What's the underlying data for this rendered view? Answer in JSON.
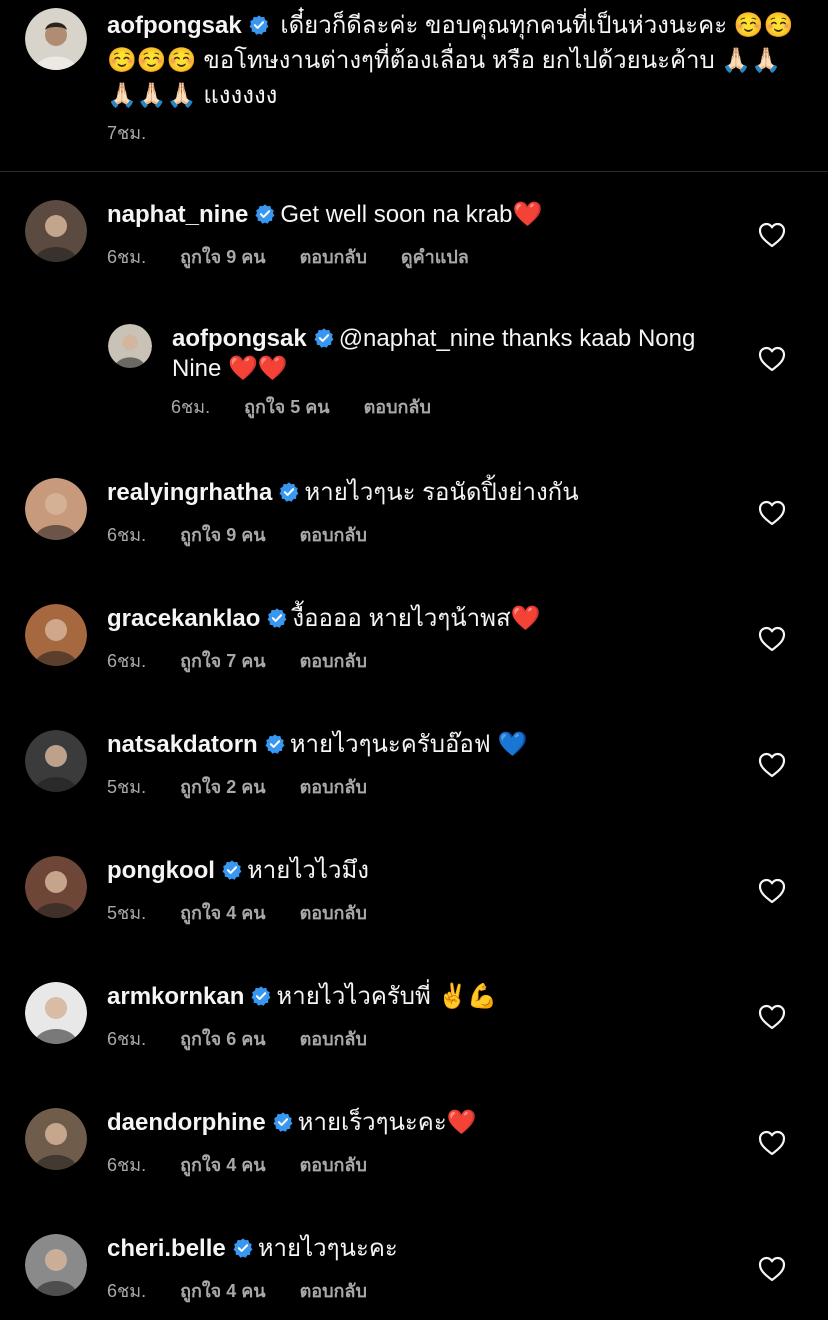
{
  "colors": {
    "background": "#000000",
    "text": "#f5f5f5",
    "secondary_text": "#a8a8a8",
    "verified_badge": "#3897f0",
    "divider": "#2a2a2a"
  },
  "icons": {
    "verified": "verified-badge-icon",
    "like": "heart-outline-icon"
  },
  "caption": {
    "username": "aofpongsak",
    "text": "เดี๋ยวก็ดีละค่ะ ขอบคุณทุกคนที่เป็นห่วงนะคะ ☺️☺️☺️☺️☺️ ขอโทษงานต่างๆที่ต้องเลื่อน หรือ ยกไปด้วยนะค้าบ 🙏🏻🙏🏻🙏🏻🙏🏻🙏🏻 แงงงงง",
    "time": "7ชม."
  },
  "comments": [
    {
      "username": "naphat_nine",
      "text": "Get well soon na krab❤️",
      "time": "6ชม.",
      "likes": "ถูกใจ 9 คน",
      "reply": "ตอบกลับ",
      "translate": "ดูคำแปล",
      "avatar_color": "#5b4a3f"
    },
    {
      "username": "aofpongsak",
      "text": "@naphat_nine thanks kaab Nong Nine ❤️❤️",
      "time": "6ชม.",
      "likes": "ถูกใจ 5 คน",
      "reply": "ตอบกลับ",
      "is_reply": true,
      "avatar_color": "#c9c2b6"
    },
    {
      "username": "realyingrhatha",
      "text": "หายไวๆนะ รอนัดปิ้งย่างกัน",
      "time": "6ชม.",
      "likes": "ถูกใจ 9 คน",
      "reply": "ตอบกลับ",
      "avatar_color": "#c79a7c"
    },
    {
      "username": "gracekanklao",
      "text": "งื้ออออ หายไวๆน้าพส❤️",
      "time": "6ชม.",
      "likes": "ถูกใจ 7 คน",
      "reply": "ตอบกลับ",
      "avatar_color": "#a6683f"
    },
    {
      "username": "natsakdatorn",
      "text": "หายไวๆนะครับอ๊อฟ 💙",
      "time": "5ชม.",
      "likes": "ถูกใจ 2 คน",
      "reply": "ตอบกลับ",
      "avatar_color": "#3b3b3b"
    },
    {
      "username": "pongkool",
      "text": "หายไวไวมึง",
      "time": "5ชม.",
      "likes": "ถูกใจ 4 คน",
      "reply": "ตอบกลับ",
      "avatar_color": "#6e4638"
    },
    {
      "username": "armkornkan",
      "text": "หายไวไวครับพี่ ✌️💪",
      "time": "6ชม.",
      "likes": "ถูกใจ 6 คน",
      "reply": "ตอบกลับ",
      "avatar_color": "#e8e8e8"
    },
    {
      "username": "daendorphine",
      "text": "หายเร็วๆนะคะ❤️",
      "time": "6ชม.",
      "likes": "ถูกใจ 4 คน",
      "reply": "ตอบกลับ",
      "avatar_color": "#6f5c4b"
    },
    {
      "username": "cheri.belle",
      "text": "หายไวๆนะคะ",
      "time": "6ชม.",
      "likes": "ถูกใจ 4 คน",
      "reply": "ตอบกลับ",
      "avatar_color": "#8a8a8a"
    }
  ]
}
